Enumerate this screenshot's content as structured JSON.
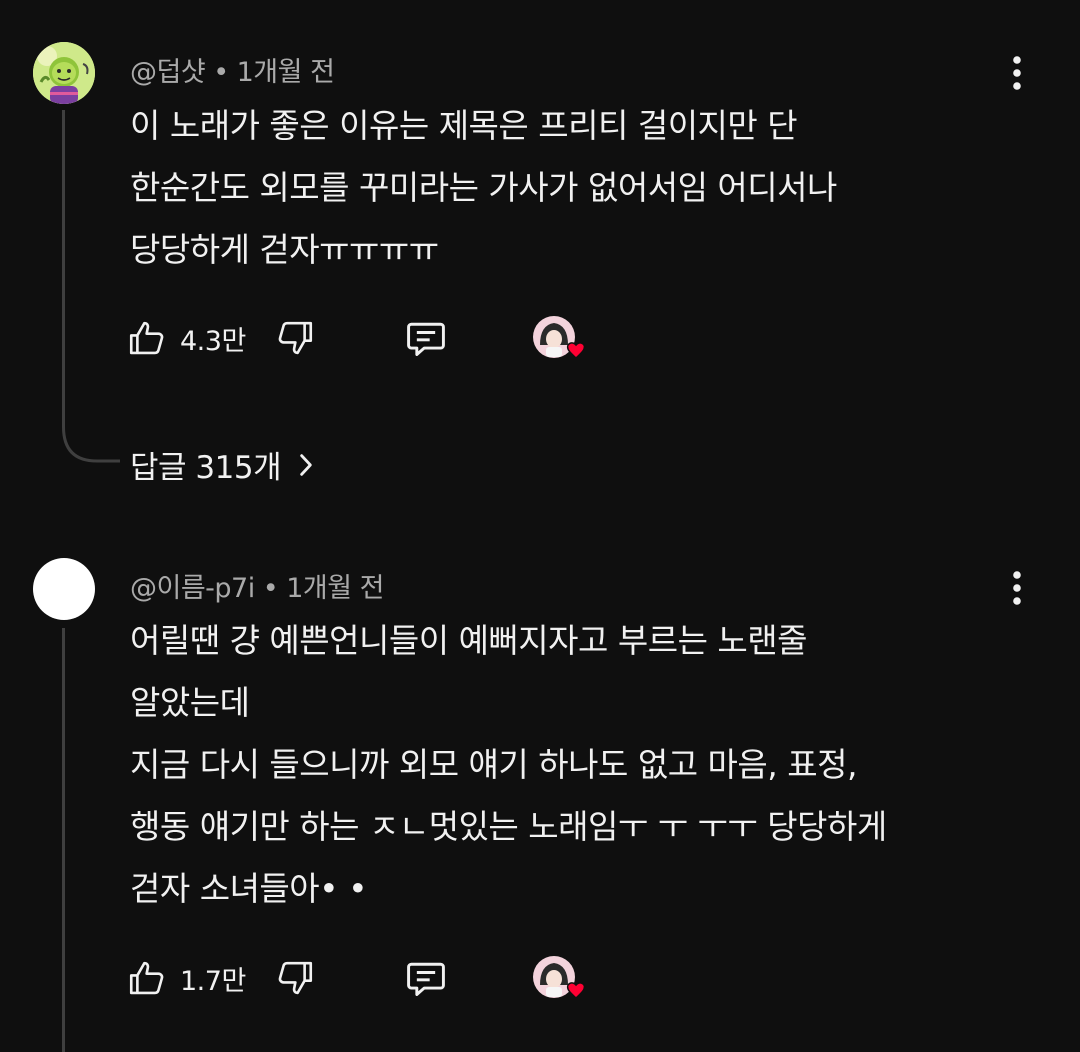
{
  "comments": [
    {
      "author": "@덥샷",
      "time": "1개월 전",
      "lines": [
        "이 노래가 좋은 이유는 제목은 프리티 걸이지만 단",
        "한순간도 외모를 꾸미라는 가사가 없어서임 어디서나",
        "당당하게 걷자ㅠㅠㅠㅠ"
      ],
      "likes": "4.3만",
      "replies_label": "답글 315개"
    },
    {
      "author": "@이름-p7i",
      "time": "1개월 전",
      "lines": [
        "어릴땐 걍 예쁜언니들이 예뻐지자고 부르는 노랜줄",
        "알았는데",
        "지금 다시 들으니까 외모 얘기 하나도 없고 마음, 표정,",
        "행동 얘기만 하는 ㅈㄴ멋있는 노래임ㅜ ㅜ ㅜㅜ 당당하게",
        "걷자 소녀들아• •"
      ],
      "likes": "1.7만"
    }
  ],
  "separator_dot": "•",
  "icons": {
    "like": "thumbs-up-icon",
    "dislike": "thumbs-down-icon",
    "reply": "comment-icon",
    "more": "more-vertical-icon",
    "creator_heart": "creator-heart-icon",
    "chevron": "chevron-right-icon"
  },
  "colors": {
    "background": "#0f0f0f",
    "text": "#f1f1f1",
    "secondary_text": "#aaaaaa",
    "thread_line": "#3f3f3f",
    "heart": "#ff0033"
  }
}
